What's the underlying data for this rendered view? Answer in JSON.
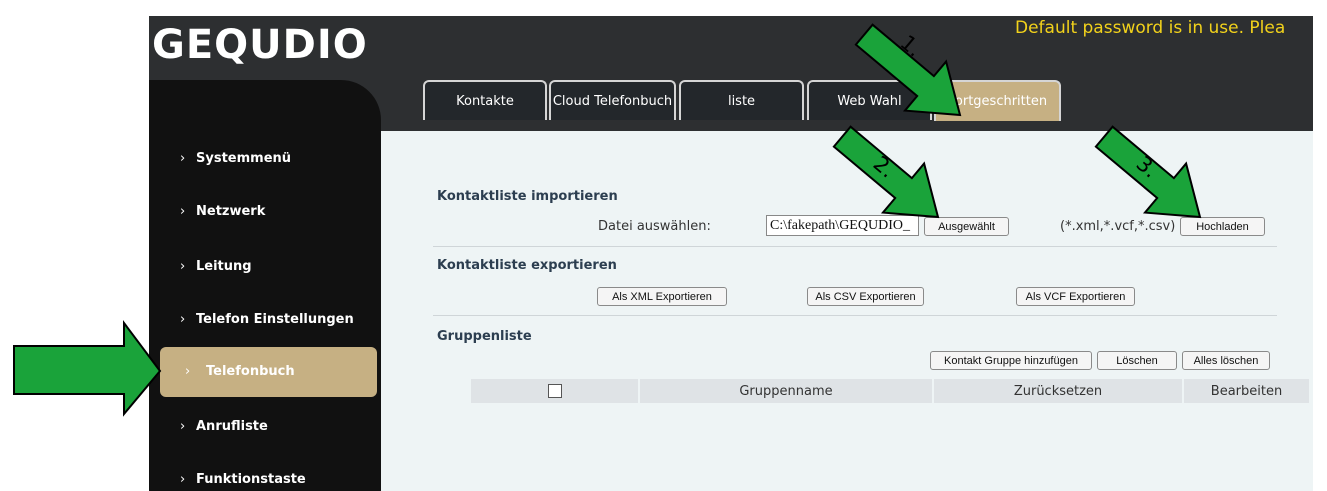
{
  "header": {
    "logo": "GEQUDIO",
    "warning": "Default password is in use. Plea"
  },
  "tabs": [
    {
      "label": "Kontakte",
      "active": false
    },
    {
      "label": "Cloud Telefonbuch",
      "active": false
    },
    {
      "label": "liste",
      "active": false
    },
    {
      "label": "Web Wahl",
      "active": false
    },
    {
      "label": "Fortgeschritten",
      "active": true
    }
  ],
  "sidebar": {
    "items": [
      {
        "label": "Systemmenü"
      },
      {
        "label": "Netzwerk"
      },
      {
        "label": "Leitung"
      },
      {
        "label": "Telefon Einstellungen"
      },
      {
        "label": "Telefonbuch",
        "active": true
      },
      {
        "label": "Anrufliste"
      },
      {
        "label": "Funktionstaste"
      }
    ],
    "chevron": "›"
  },
  "import": {
    "title": "Kontaktliste importieren",
    "file_label": "Datei auswählen:",
    "file_value": "C:\\fakepath\\GEQUDIO_",
    "browse_button": "Ausgewählt",
    "formats": "(*.xml,*.vcf,*.csv)",
    "upload_button": "Hochladen"
  },
  "export": {
    "title": "Kontaktliste exportieren",
    "xml_button": "Als XML Exportieren",
    "csv_button": "Als CSV Exportieren",
    "vcf_button": "Als VCF Exportieren"
  },
  "groups": {
    "title": "Gruppenliste",
    "add_button": "Kontakt Gruppe hinzufügen",
    "delete_button": "Löschen",
    "delete_all_button": "Alles löschen",
    "columns": [
      "Gruppenname",
      "Zurücksetzen",
      "Bearbeiten"
    ]
  },
  "annotations": {
    "arrow1": "1.",
    "arrow2": "2.",
    "arrow3": "3.",
    "color": "#1aa33a"
  }
}
